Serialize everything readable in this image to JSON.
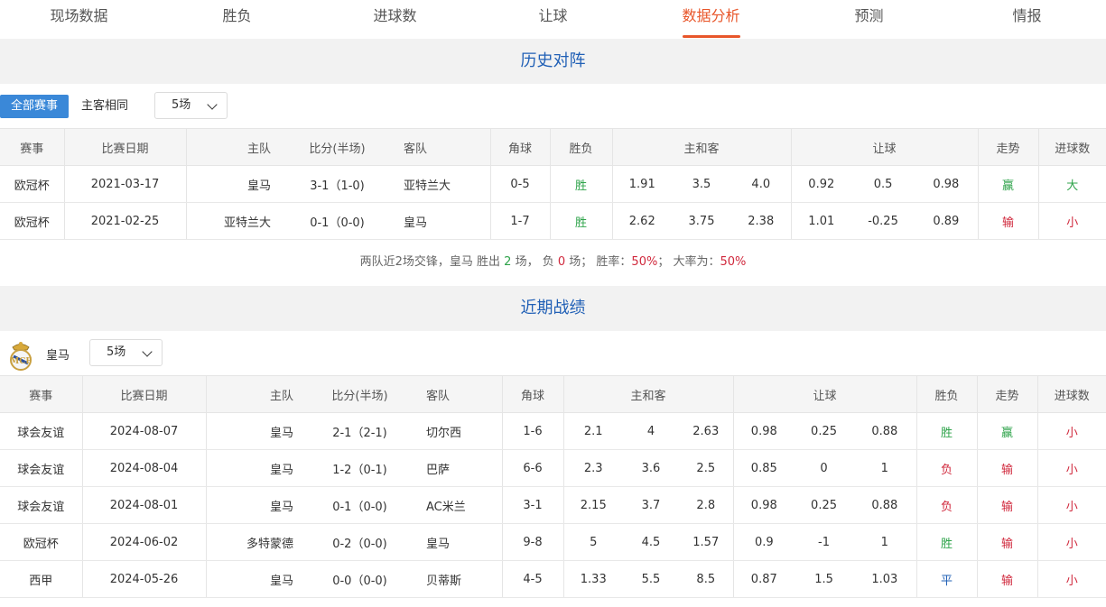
{
  "tabs": [
    {
      "label": "现场数据",
      "active": false
    },
    {
      "label": "胜负",
      "active": false
    },
    {
      "label": "进球数",
      "active": false
    },
    {
      "label": "让球",
      "active": false
    },
    {
      "label": "数据分析",
      "active": true
    },
    {
      "label": "预测",
      "active": false
    },
    {
      "label": "情报",
      "active": false
    }
  ],
  "colors": {
    "accent": "#e8562a",
    "title_blue": "#2160b6",
    "win": "#2ea34a",
    "lose": "#d0283c",
    "button_blue": "#3a88d8"
  },
  "history": {
    "title": "历史对阵",
    "filter_all": "全部赛事",
    "filter_same": "主客相同",
    "count_select": "5场",
    "headers": {
      "league": "赛事",
      "date": "比赛日期",
      "home": "主队",
      "score": "比分(半场)",
      "away": "客队",
      "corner": "角球",
      "result": "胜负",
      "odds": "主和客",
      "handicap": "让球",
      "trend": "走势",
      "goals": "进球数"
    },
    "rows": [
      {
        "league": "欧冠杯",
        "date": "2021-03-17",
        "home": "皇马",
        "score": "3-1（1-0)",
        "away": "亚特兰大",
        "corner": "0-5",
        "result": "胜",
        "odds": [
          "1.91",
          "3.5",
          "4.0"
        ],
        "handicap": [
          "0.92",
          "0.5",
          "0.98"
        ],
        "trend": "赢",
        "goals": "大"
      },
      {
        "league": "欧冠杯",
        "date": "2021-02-25",
        "home": "亚特兰大",
        "score": "0-1（0-0)",
        "away": "皇马",
        "corner": "1-7",
        "result": "胜",
        "odds": [
          "2.62",
          "3.75",
          "2.38"
        ],
        "handicap": [
          "1.01",
          "-0.25",
          "0.89"
        ],
        "trend": "输",
        "goals": "小"
      }
    ],
    "summary": {
      "prefix": "两队近2场交锋，皇马 胜出",
      "wins": "2",
      "mid1": "场， 负",
      "losses": "0",
      "mid2": "场；  胜率：",
      "win_rate": "50%",
      "mid3": "；  大率为：",
      "big_rate": "50%"
    }
  },
  "recent": {
    "title": "近期战绩",
    "team_name": "皇马",
    "count_select": "5场",
    "headers": {
      "league": "赛事",
      "date": "比赛日期",
      "home": "主队",
      "score": "比分(半场)",
      "away": "客队",
      "corner": "角球",
      "odds": "主和客",
      "handicap": "让球",
      "result": "胜负",
      "trend": "走势",
      "goals": "进球数"
    },
    "rows": [
      {
        "league": "球会友谊",
        "date": "2024-08-07",
        "home": "皇马",
        "score": "2-1（2-1)",
        "away": "切尔西",
        "corner": "1-6",
        "odds": [
          "2.1",
          "4",
          "2.63"
        ],
        "handicap": [
          "0.98",
          "0.25",
          "0.88"
        ],
        "result": "胜",
        "trend": "赢",
        "goals": "小"
      },
      {
        "league": "球会友谊",
        "date": "2024-08-04",
        "home": "皇马",
        "score": "1-2（0-1)",
        "away": "巴萨",
        "corner": "6-6",
        "odds": [
          "2.3",
          "3.6",
          "2.5"
        ],
        "handicap": [
          "0.85",
          "0",
          "1"
        ],
        "result": "负",
        "trend": "输",
        "goals": "小"
      },
      {
        "league": "球会友谊",
        "date": "2024-08-01",
        "home": "皇马",
        "score": "0-1（0-0)",
        "away": "AC米兰",
        "corner": "3-1",
        "odds": [
          "2.15",
          "3.7",
          "2.8"
        ],
        "handicap": [
          "0.98",
          "0.25",
          "0.88"
        ],
        "result": "负",
        "trend": "输",
        "goals": "小"
      },
      {
        "league": "欧冠杯",
        "date": "2024-06-02",
        "home": "多特蒙德",
        "score": "0-2（0-0)",
        "away": "皇马",
        "corner": "9-8",
        "odds": [
          "5",
          "4.5",
          "1.57"
        ],
        "handicap": [
          "0.9",
          "-1",
          "1"
        ],
        "result": "胜",
        "trend": "输",
        "goals": "小"
      },
      {
        "league": "西甲",
        "date": "2024-05-26",
        "home": "皇马",
        "score": "0-0（0-0)",
        "away": "贝蒂斯",
        "corner": "4-5",
        "odds": [
          "1.33",
          "5.5",
          "8.5"
        ],
        "handicap": [
          "0.87",
          "1.5",
          "1.03"
        ],
        "result": "平",
        "trend": "输",
        "goals": "小"
      }
    ]
  }
}
